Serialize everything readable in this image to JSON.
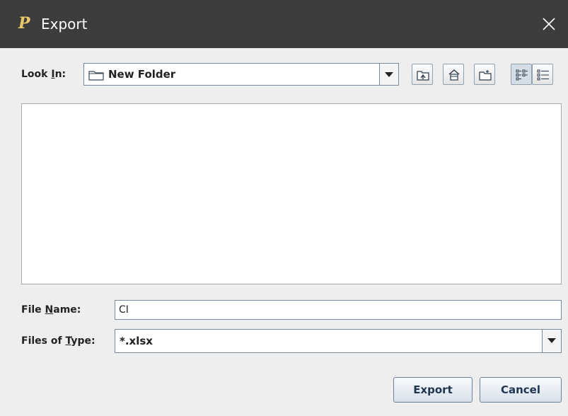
{
  "window": {
    "title": "Export",
    "app_icon_letter": "P"
  },
  "look_in": {
    "label_pre": "Look ",
    "label_mnemonic": "I",
    "label_post": "n:",
    "value": "New Folder"
  },
  "toolbar": {
    "icons": [
      "up-folder-icon",
      "home-icon",
      "new-folder-icon",
      "list-view-icon",
      "details-view-icon"
    ]
  },
  "file_name": {
    "label_pre": "File ",
    "label_mnemonic": "N",
    "label_post": "ame:",
    "value": "CI"
  },
  "files_of_type": {
    "label_pre": "Files of ",
    "label_mnemonic": "T",
    "label_post": "ype:",
    "value": "*.xlsx"
  },
  "buttons": {
    "export": "Export",
    "cancel": "Cancel"
  },
  "colors": {
    "titlebar": "#3c3c3c",
    "background": "#eeeeee",
    "button_text": "#1f3652"
  }
}
